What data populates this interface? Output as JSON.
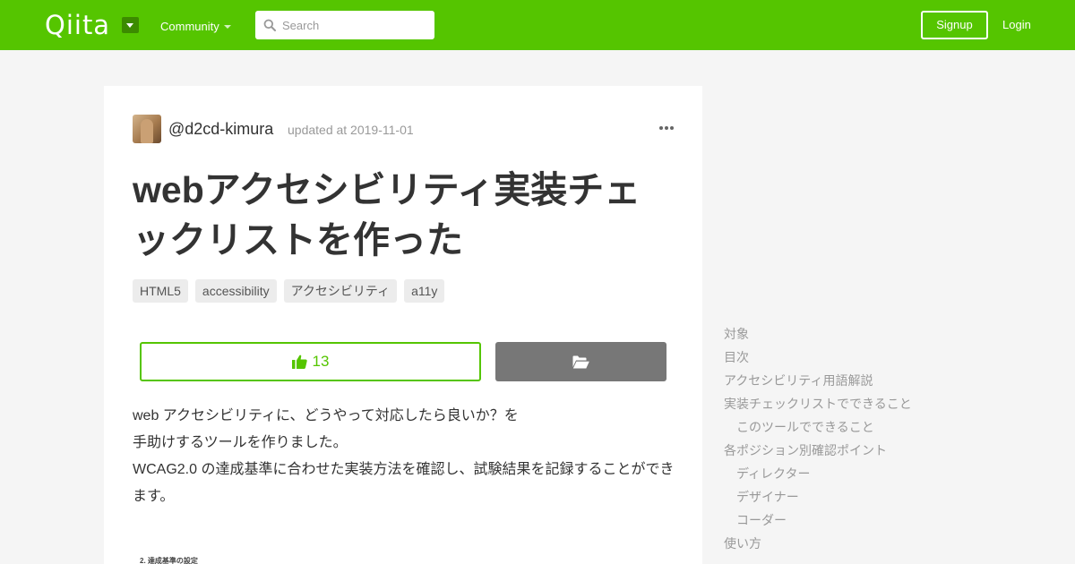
{
  "header": {
    "logo_text": "Qiita",
    "community_label": "Community",
    "search_placeholder": "Search",
    "signup_label": "Signup",
    "login_label": "Login",
    "brand_color": "#55c500"
  },
  "article": {
    "author": "@d2cd-kimura",
    "updated": "updated at 2019-11-01",
    "title": "webアクセシビリティ実装チェックリストを作った",
    "tags": [
      "HTML5",
      "accessibility",
      "アクセシビリティ",
      "a11y"
    ],
    "like_count": "13",
    "body_lines": [
      "web アクセシビリティに、どうやって対応したら良いか？を",
      "手助けするツールを作りました。",
      "WCAG2.0 の達成基準に合わせた実装方法を確認し、試験結果を記録することができます。"
    ],
    "image_caption": "2. 達成基準の設定"
  },
  "toc": {
    "items": [
      {
        "label": "対象",
        "level": 1
      },
      {
        "label": "目次",
        "level": 1
      },
      {
        "label": "アクセシビリティ用語解説",
        "level": 1
      },
      {
        "label": "実装チェックリストでできること",
        "level": 1
      },
      {
        "label": "このツールでできること",
        "level": 2
      },
      {
        "label": "各ポジション別確認ポイント",
        "level": 1
      },
      {
        "label": "ディレクター",
        "level": 2
      },
      {
        "label": "デザイナー",
        "level": 2
      },
      {
        "label": "コーダー",
        "level": 2
      },
      {
        "label": "使い方",
        "level": 1
      }
    ]
  }
}
